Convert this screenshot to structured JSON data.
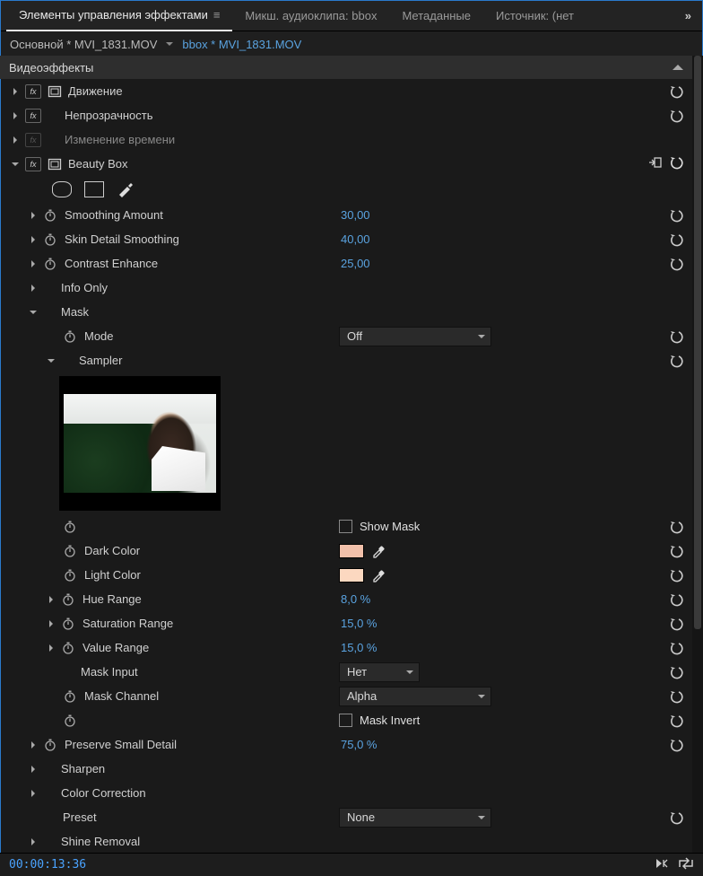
{
  "tabs": {
    "effects": "Элементы управления эффектами",
    "mixer": "Микш. аудиоклипа: bbox",
    "metadata": "Метаданные",
    "source": "Источник: (нет"
  },
  "breadcrumb": {
    "master": "Основной * MVI_1831.MOV",
    "clip": "bbox * MVI_1831.MOV"
  },
  "section": {
    "video_effects": "Видеоэффекты"
  },
  "fx": {
    "motion": "Движение",
    "opacity": "Непрозрачность",
    "time_remap": "Изменение времени",
    "beauty_box": "Beauty Box"
  },
  "bb": {
    "smoothing_amount": {
      "label": "Smoothing Amount",
      "value": "30,00"
    },
    "skin_detail": {
      "label": "Skin Detail Smoothing",
      "value": "40,00"
    },
    "contrast_enhance": {
      "label": "Contrast Enhance",
      "value": "25,00"
    },
    "info_only": "Info Only",
    "mask": "Mask",
    "mode": {
      "label": "Mode",
      "value": "Off"
    },
    "sampler": "Sampler",
    "show_mask": "Show Mask",
    "dark_color": {
      "label": "Dark Color",
      "hex": "#f1c0aa"
    },
    "light_color": {
      "label": "Light Color",
      "hex": "#fcd8c0"
    },
    "hue_range": {
      "label": "Hue Range",
      "value": "8,0 %"
    },
    "sat_range": {
      "label": "Saturation Range",
      "value": "15,0 %"
    },
    "val_range": {
      "label": "Value Range",
      "value": "15,0 %"
    },
    "mask_input": {
      "label": "Mask Input",
      "value": "Нет"
    },
    "mask_channel": {
      "label": "Mask Channel",
      "value": "Alpha"
    },
    "mask_invert": "Mask Invert",
    "preserve_small": {
      "label": "Preserve Small Detail",
      "value": "75,0 %"
    },
    "sharpen": "Sharpen",
    "color_correction": "Color Correction",
    "preset": {
      "label": "Preset",
      "value": "None"
    },
    "shine_removal": "Shine Removal"
  },
  "timecode": "00:00:13:36"
}
